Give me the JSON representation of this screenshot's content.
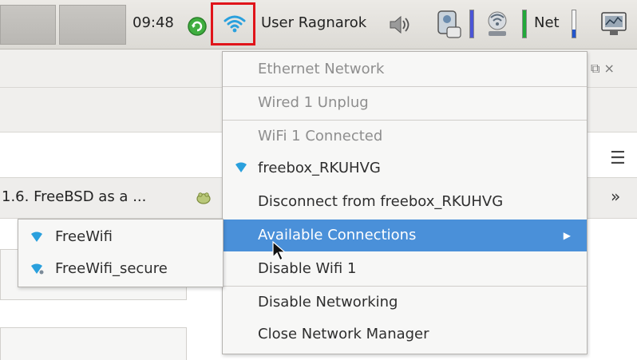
{
  "taskbar": {
    "clock": "09:48",
    "user_label": "User Ragnarok",
    "net_label": "Net",
    "icons": [
      "update-icon",
      "wifi-icon",
      "volume-icon",
      "usb-device-icon",
      "wireless-status-icon",
      "system-monitor-icon"
    ],
    "highlight_color": "#e0141a"
  },
  "browser": {
    "bookmark_text": "1.6. FreeBSD as a ...",
    "window_controls": "⧉  ×",
    "menu_glyph": "☰",
    "overflow_glyph": "»"
  },
  "network_menu": {
    "items": [
      {
        "label": "Ethernet Network",
        "state": "disabled"
      },
      {
        "label": "Wired 1 Unplug",
        "state": "disabled"
      },
      {
        "label": "WiFi 1 Connected",
        "state": "disabled"
      },
      {
        "label": "freebox_RKUHVG",
        "state": "normal",
        "icon": "wifi-signal-icon"
      },
      {
        "label": "Disconnect from freebox_RKUHVG",
        "state": "normal"
      },
      {
        "label": "Available Connections",
        "state": "active",
        "submenu": true
      },
      {
        "label": "Disable Wifi 1",
        "state": "normal"
      },
      {
        "label": "Disable Networking",
        "state": "normal"
      },
      {
        "label": "Close Network Manager",
        "state": "normal"
      }
    ],
    "active_color": "#4a90d9"
  },
  "available_connections": {
    "items": [
      {
        "label": "FreeWifi",
        "icon": "wifi-signal-icon"
      },
      {
        "label": "FreeWifi_secure",
        "icon": "wifi-secure-icon"
      }
    ]
  }
}
